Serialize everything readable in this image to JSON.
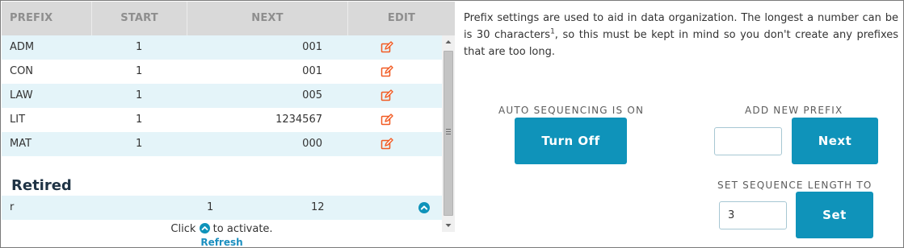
{
  "table": {
    "headers": {
      "prefix": "PREFIX",
      "start": "START",
      "next": "NEXT",
      "edit": "EDIT"
    },
    "rows": [
      {
        "prefix": "ADM",
        "start": "1",
        "next": "001"
      },
      {
        "prefix": "CON",
        "start": "1",
        "next": "001"
      },
      {
        "prefix": "LAW",
        "start": "1",
        "next": "005"
      },
      {
        "prefix": "LIT",
        "start": "1",
        "next": "1234567"
      },
      {
        "prefix": "MAT",
        "start": "1",
        "next": "000"
      }
    ]
  },
  "retired": {
    "title": "Retired",
    "rows": [
      {
        "prefix": "r",
        "start": "1",
        "next": "12"
      }
    ],
    "hint_before": "Click",
    "hint_after": "to activate.",
    "refresh_label": "Refresh"
  },
  "info": {
    "text_before": "Prefix settings are used to aid in data organization. The longest a number can be is 30 characters",
    "superscript": "1",
    "text_after": ", so this must be kept in mind so you don't create any prefixes that are too long."
  },
  "auto_sequencing": {
    "label": "AUTO SEQUENCING IS ON",
    "button": "Turn Off"
  },
  "add_prefix": {
    "label": "ADD NEW PREFIX",
    "value": "",
    "button": "Next"
  },
  "sequence_length": {
    "label": "SET SEQUENCE LENGTH TO",
    "value": "3",
    "button": "Set"
  },
  "colors": {
    "accent": "#0f93ba",
    "row_alt": "#e4f4f9",
    "header_bg": "#d9d9d9",
    "edit_icon": "#f15a22"
  },
  "icons": {
    "edit": "edit-pencil-icon",
    "activate": "chevron-up-circle-icon"
  }
}
